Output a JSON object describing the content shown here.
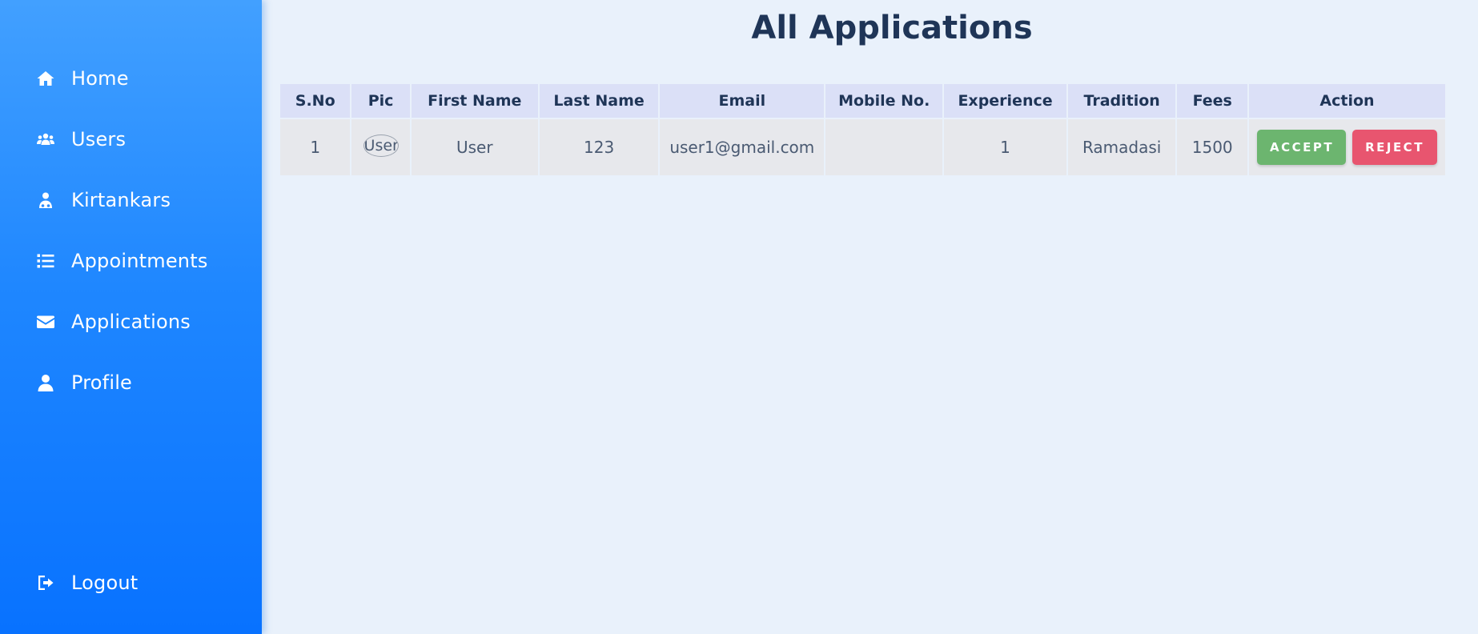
{
  "sidebar": {
    "items": [
      {
        "label": "Home",
        "icon": "home-icon"
      },
      {
        "label": "Users",
        "icon": "users-icon"
      },
      {
        "label": "Kirtankars",
        "icon": "kirtankar-icon"
      },
      {
        "label": "Appointments",
        "icon": "list-icon"
      },
      {
        "label": "Applications",
        "icon": "envelope-icon"
      },
      {
        "label": "Profile",
        "icon": "user-icon"
      }
    ],
    "logout": {
      "label": "Logout",
      "icon": "logout-icon"
    }
  },
  "main": {
    "title": "All Applications",
    "table": {
      "headers": [
        "S.No",
        "Pic",
        "First Name",
        "Last Name",
        "Email",
        "Mobile No.",
        "Experience",
        "Tradition",
        "Fees",
        "Action"
      ],
      "rows": [
        {
          "sno": "1",
          "pic_alt": "User",
          "first_name": "User",
          "last_name": "123",
          "email": "user1@gmail.com",
          "mobile": "",
          "experience": "1",
          "tradition": "Ramadasi",
          "fees": "1500",
          "accept_label": "ACCEPT",
          "reject_label": "REJECT"
        }
      ]
    }
  },
  "colors": {
    "sidebar_top": "#42a0ff",
    "sidebar_bottom": "#0872ff",
    "background": "#e9f1fb",
    "title": "#1f3557",
    "header_bg": "#dbe0f7",
    "row_bg": "#e7e8ec",
    "accept": "#6cb56f",
    "reject": "#e8556f"
  }
}
